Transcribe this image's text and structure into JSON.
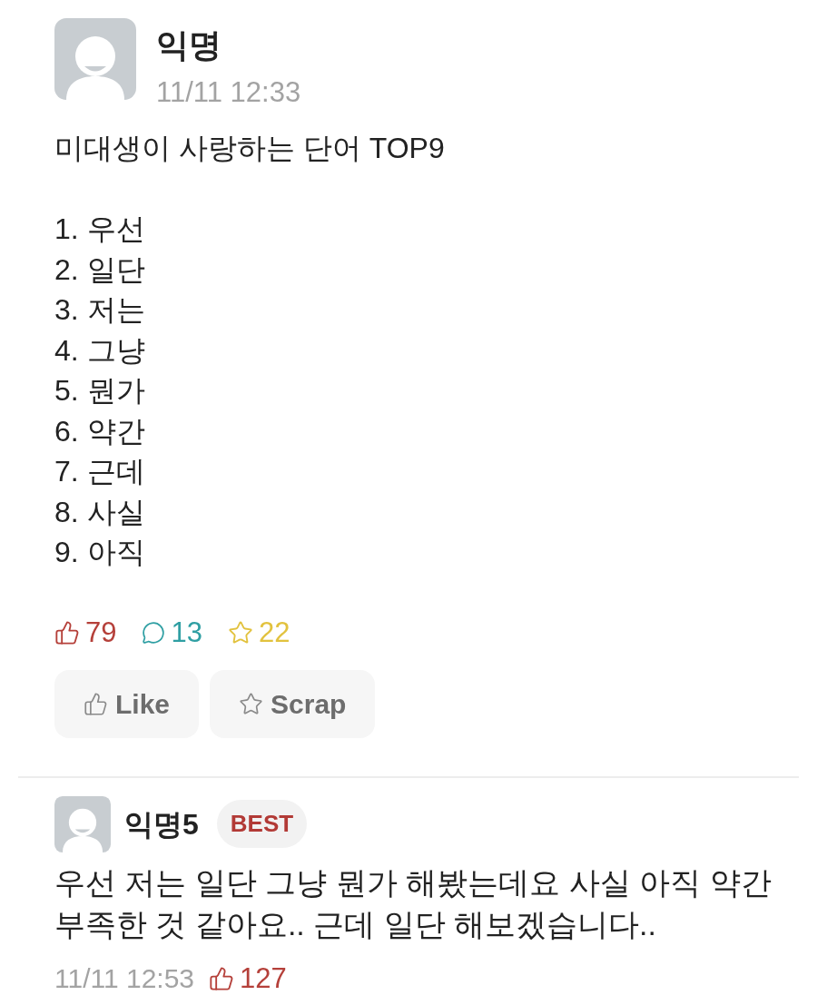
{
  "post": {
    "author": "익명",
    "time": "11/11 12:33",
    "title": "미대생이 사랑하는 단어 TOP9",
    "items": [
      "1. 우선",
      "2. 일단",
      "3. 저는",
      "4. 그냥",
      "5. 뭔가",
      "6. 약간",
      "7. 근데",
      "8. 사실",
      "9. 아직"
    ],
    "stats": [
      {
        "kind": "like",
        "count": "79",
        "color": "#b5403a"
      },
      {
        "kind": "comment",
        "count": "13",
        "color": "#2f9fa3"
      },
      {
        "kind": "scrap",
        "count": "22",
        "color": "#e2c23e"
      }
    ],
    "buttons": [
      {
        "kind": "like",
        "label": "Like"
      },
      {
        "kind": "scrap",
        "label": "Scrap"
      }
    ]
  },
  "comments": [
    {
      "author": "익명5",
      "badge": "BEST",
      "text": "우선 저는 일단 그냥 뭔가 해봤는데요 사실 아직 약간 부족한 것 같아요.. 근데 일단 해보겠습니다..",
      "time": "11/11 12:53",
      "likes": "127"
    }
  ]
}
